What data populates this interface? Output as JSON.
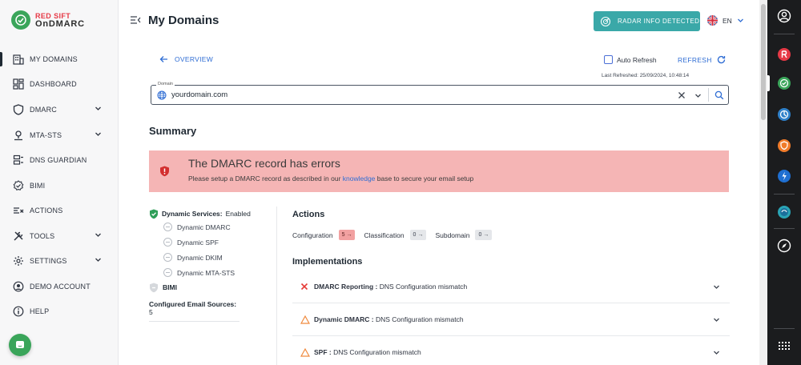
{
  "brand": {
    "line1": "RED SIFT",
    "line2": "OnDMARC"
  },
  "sidebar": {
    "items": [
      {
        "label": "MY DOMAINS",
        "icon": "building-icon",
        "active": true,
        "has_chevron": false
      },
      {
        "label": "DASHBOARD",
        "icon": "dashboard-icon",
        "active": false,
        "has_chevron": false
      },
      {
        "label": "DMARC",
        "icon": "shield-icon",
        "active": false,
        "has_chevron": true
      },
      {
        "label": "MTA-STS",
        "icon": "map-pin-icon",
        "active": false,
        "has_chevron": true
      },
      {
        "label": "DNS GUARDIAN",
        "icon": "dns-server-icon",
        "active": false,
        "has_chevron": false
      },
      {
        "label": "BIMI",
        "icon": "badge-check-icon",
        "active": false,
        "has_chevron": false
      },
      {
        "label": "ACTIONS",
        "icon": "actions-list-icon",
        "active": false,
        "has_chevron": false
      },
      {
        "label": "TOOLS",
        "icon": "tools-icon",
        "active": false,
        "has_chevron": true
      },
      {
        "label": "SETTINGS",
        "icon": "gear-icon",
        "active": false,
        "has_chevron": true
      },
      {
        "label": "DEMO ACCOUNT",
        "icon": "demo-account-icon",
        "active": false,
        "has_chevron": false
      },
      {
        "label": "HELP",
        "icon": "info-icon",
        "active": false,
        "has_chevron": false
      }
    ]
  },
  "header": {
    "title": "My Domains",
    "radar_button": "RADAR INFO DETECTED",
    "language": "EN"
  },
  "toolbar": {
    "overview_label": "OVERVIEW",
    "auto_refresh_label": "Auto Refresh",
    "auto_refresh_checked": false,
    "refresh_label": "REFRESH",
    "last_refreshed": "Last Refreshed: 25/09/2024, 10:48:14"
  },
  "domain_select": {
    "legend": "Domain",
    "value": "yourdomain.com"
  },
  "summary": {
    "title": "Summary",
    "alert": {
      "title": "The DMARC record has errors",
      "message_before": "Please setup a DMARC record as described in our ",
      "message_link": "knowledge",
      "message_after": " base to secure your email setup",
      "color": "#f5b5b5"
    }
  },
  "services": {
    "header_label": "Dynamic Services:",
    "header_status": "Enabled",
    "items": [
      "Dynamic DMARC",
      "Dynamic SPF",
      "Dynamic DKIM",
      "Dynamic MTA-STS"
    ],
    "bimi_label": "BIMI",
    "configured_sources_label": "Configured Email Sources:",
    "configured_sources_count": "5"
  },
  "actions": {
    "title": "Actions",
    "groups": [
      {
        "label": "Configuration",
        "count": "5",
        "error": true
      },
      {
        "label": "Classification",
        "count": "0",
        "error": false
      },
      {
        "label": "Subdomain",
        "count": "0",
        "error": false
      }
    ]
  },
  "implementations": {
    "title": "Implementations",
    "rows": [
      {
        "status": "error",
        "name": "DMARC Reporting :",
        "detail": " DNS Configuration mismatch"
      },
      {
        "status": "warning",
        "name": "Dynamic DMARC :",
        "detail": " DNS Configuration mismatch"
      },
      {
        "status": "warning",
        "name": "SPF :",
        "detail": " DNS Configuration mismatch"
      }
    ]
  },
  "colors": {
    "accent": "#2f6dd4",
    "radar": "#3aa8a8",
    "brand_green": "#3aa55a",
    "error": "#e53935",
    "warning": "#f08a3e"
  }
}
